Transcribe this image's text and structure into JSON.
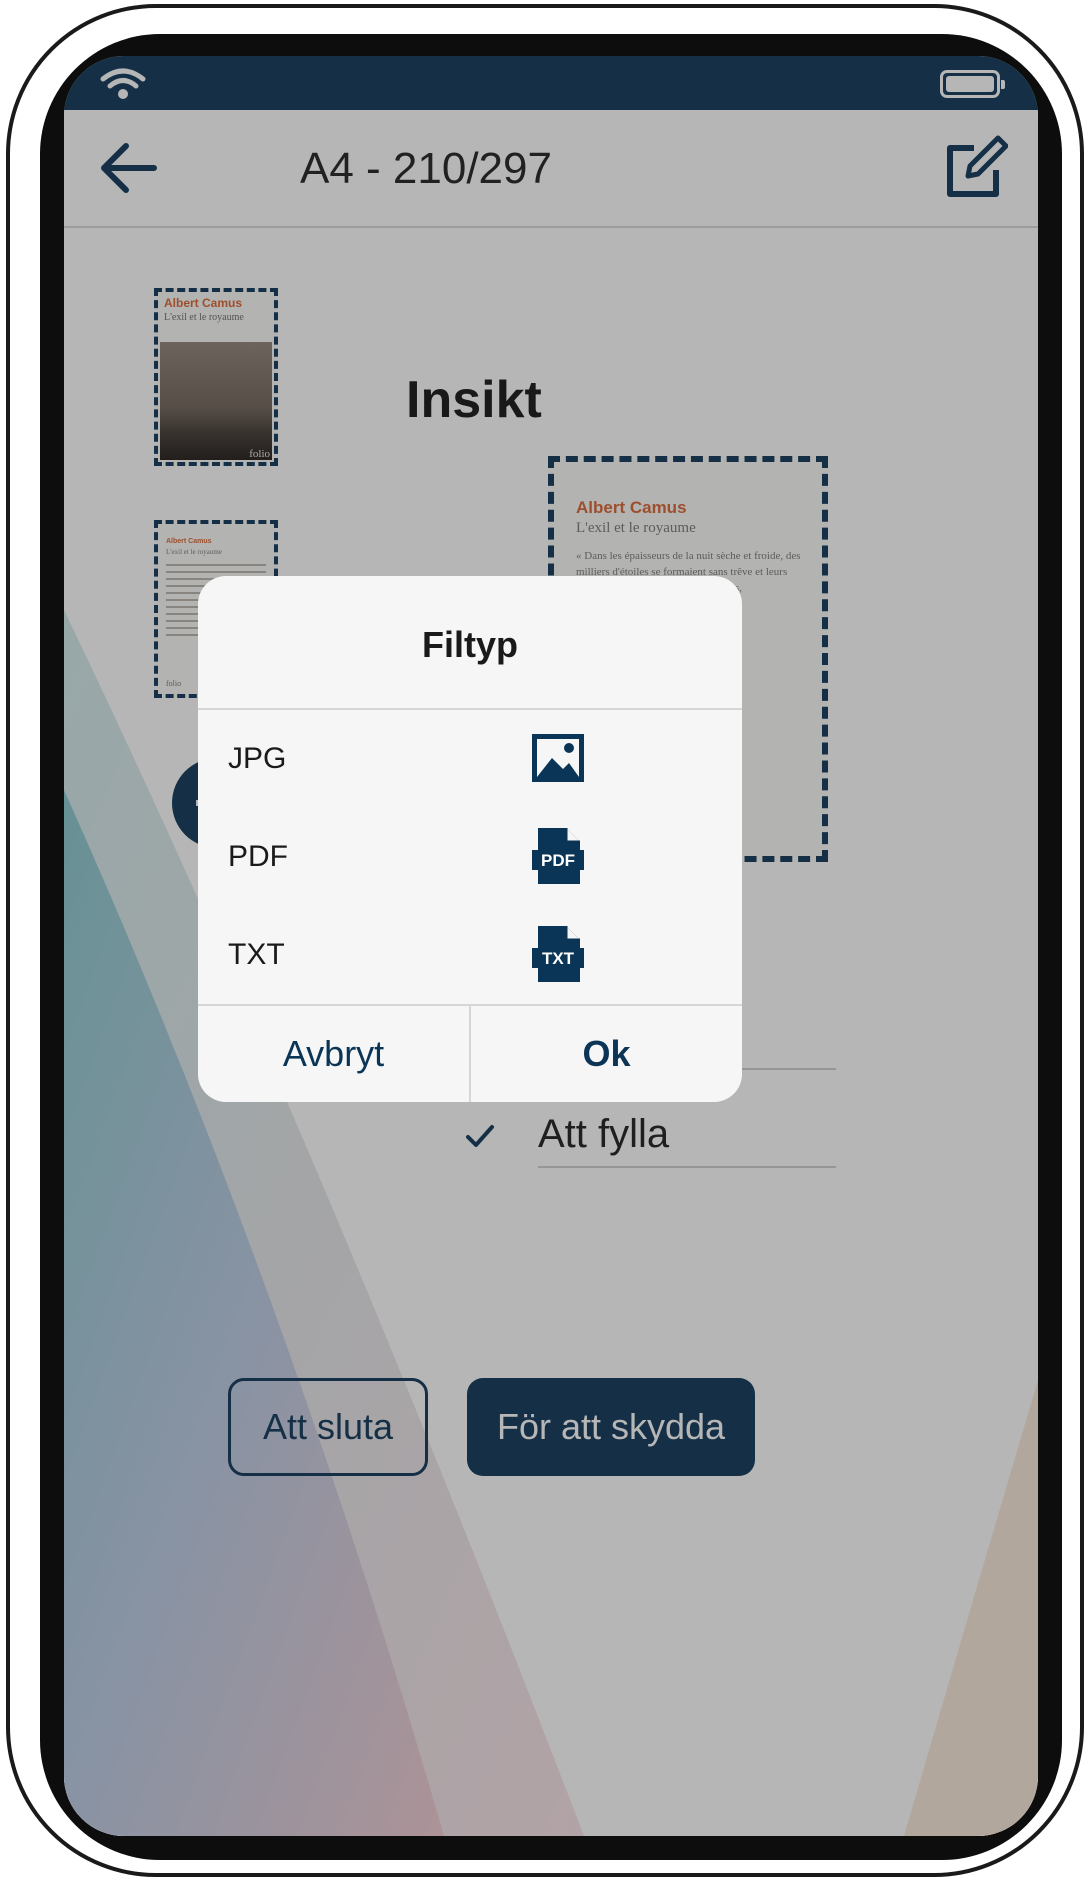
{
  "colors": {
    "primary": "#0b3556",
    "accent_orange": "#d9632f",
    "dialog_bg": "#f6f6f6",
    "scrim": "rgba(40,40,40,0.34)"
  },
  "status_bar": {
    "icons": [
      "wifi-icon",
      "battery-icon"
    ]
  },
  "app_bar": {
    "back_icon": "arrow-left-icon",
    "title": "A4 - 210/297",
    "edit_icon": "edit-icon"
  },
  "thumbnails": {
    "cover": {
      "author": "Albert Camus",
      "title": "L'exil et le royaume",
      "publisher": "folio"
    },
    "page": {
      "author": "Albert Camus",
      "title": "L'exil et le royaume",
      "publisher": "folio"
    }
  },
  "preview": {
    "heading": "Insikt",
    "page": {
      "author": "Albert Camus",
      "title": "L'exil et le royaume",
      "text": "« Dans les épaisseurs de la nuit sèche et froide, des milliers d'étoiles se formaient sans trêve et leurs glaçons étincelants, aussitôt détachés, commençaient de"
    }
  },
  "add_button": {
    "icon": "plus-icon"
  },
  "options_list": {
    "checked_item": "Att fylla",
    "check_icon": "check-icon"
  },
  "bottom_buttons": {
    "secondary_label": "Att sluta",
    "primary_label": "För att skydda"
  },
  "dialog": {
    "title": "Filtyp",
    "options": [
      {
        "label": "JPG",
        "icon": "image-icon"
      },
      {
        "label": "PDF",
        "icon": "pdf-file-icon",
        "icon_text": "PDF"
      },
      {
        "label": "TXT",
        "icon": "txt-file-icon",
        "icon_text": "TXT"
      }
    ],
    "cancel_label": "Avbryt",
    "ok_label": "Ok"
  }
}
